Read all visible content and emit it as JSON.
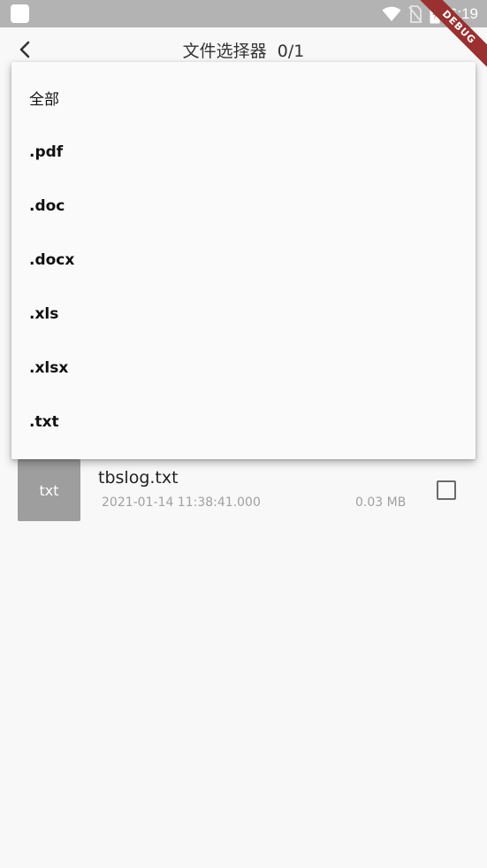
{
  "status_bar": {
    "time": "6:19",
    "icons": [
      "app-square-icon",
      "wifi-icon",
      "no-sim-icon",
      "battery-charging-icon"
    ]
  },
  "debug_banner": {
    "label": "DEBUG"
  },
  "app_bar": {
    "back_icon": "chevron-left-icon",
    "title": "文件选择器",
    "counter": "0/1"
  },
  "filter_menu": {
    "items": [
      {
        "label": "全部"
      },
      {
        "label": ".pdf"
      },
      {
        "label": ".doc"
      },
      {
        "label": ".docx"
      },
      {
        "label": ".xls"
      },
      {
        "label": ".xlsx"
      },
      {
        "label": ".txt"
      }
    ]
  },
  "files": [
    {
      "thumb_label": "txt",
      "name": "tbslog.txt",
      "date": "2021-01-14 11:38:41.000",
      "size": "0.03 MB",
      "checked": false
    }
  ],
  "colors": {
    "status_bar": "#b3b3b3",
    "background": "#f8f8f8",
    "thumb": "#9e9e9e",
    "debug_ribbon": "#9a3030"
  }
}
